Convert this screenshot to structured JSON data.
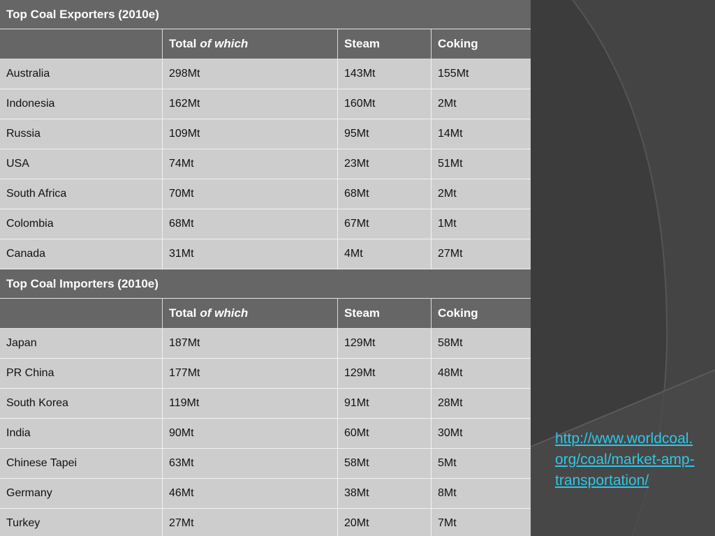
{
  "exporters": {
    "title": "Top Coal Exporters (2010e)",
    "headers": {
      "total": "Total",
      "total_suffix": "of which",
      "steam": "Steam",
      "coking": "Coking"
    },
    "rows": [
      {
        "country": "Australia",
        "total": "298Mt",
        "steam": "143Mt",
        "coking": "155Mt"
      },
      {
        "country": "Indonesia",
        "total": "162Mt",
        "steam": "160Mt",
        "coking": "2Mt"
      },
      {
        "country": "Russia",
        "total": "109Mt",
        "steam": "95Mt",
        "coking": "14Mt"
      },
      {
        "country": "USA",
        "total": "74Mt",
        "steam": "23Mt",
        "coking": "51Mt"
      },
      {
        "country": "South Africa",
        "total": "70Mt",
        "steam": "68Mt",
        "coking": "2Mt"
      },
      {
        "country": "Colombia",
        "total": "68Mt",
        "steam": "67Mt",
        "coking": "1Mt"
      },
      {
        "country": "Canada",
        "total": "31Mt",
        "steam": "4Mt",
        "coking": "27Mt"
      }
    ]
  },
  "importers": {
    "title": "Top Coal Importers (2010e)",
    "headers": {
      "total": "Total",
      "total_suffix": "of which",
      "steam": "Steam",
      "coking": "Coking"
    },
    "rows": [
      {
        "country": "Japan",
        "total": "187Mt",
        "steam": "129Mt",
        "coking": "58Mt"
      },
      {
        "country": "PR China",
        "total": "177Mt",
        "steam": "129Mt",
        "coking": "48Mt"
      },
      {
        "country": "South Korea",
        "total": "119Mt",
        "steam": "91Mt",
        "coking": "28Mt"
      },
      {
        "country": "India",
        "total": "90Mt",
        "steam": "60Mt",
        "coking": "30Mt"
      },
      {
        "country": "Chinese Tapei",
        "total": "63Mt",
        "steam": "58Mt",
        "coking": "5Mt"
      },
      {
        "country": "Germany",
        "total": "46Mt",
        "steam": "38Mt",
        "coking": "8Mt"
      },
      {
        "country": "Turkey",
        "total": "27Mt",
        "steam": "20Mt",
        "coking": "7Mt"
      }
    ]
  },
  "source_link": "http://www.worldcoal.org/coal/market-amp-transportation/",
  "colors": {
    "background": "#3a3a3a",
    "header": "#666666",
    "cell": "#cdcdcd",
    "link": "#2fc7e6"
  }
}
